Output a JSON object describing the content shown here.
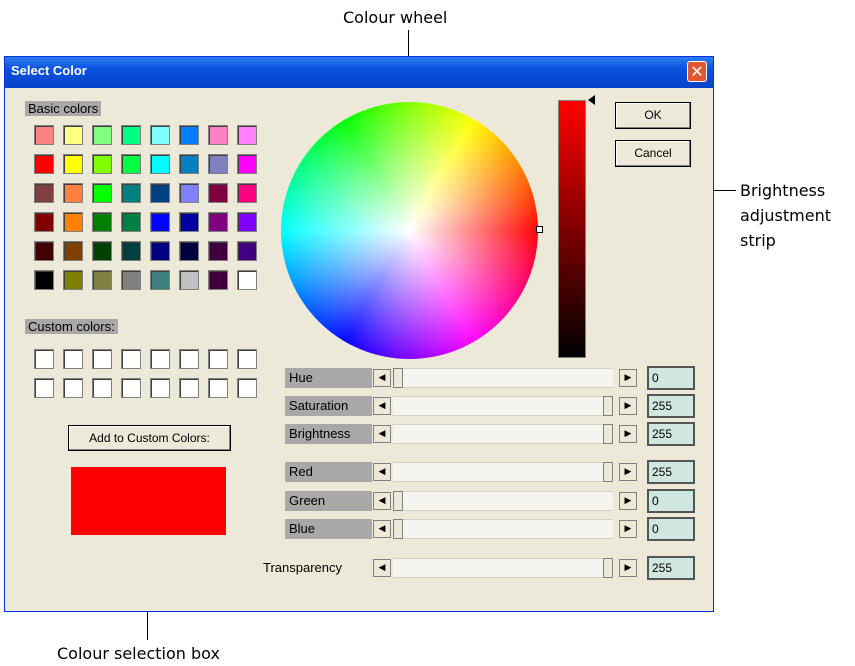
{
  "annotations": {
    "wheel": "Colour wheel",
    "brightness_line1": "Brightness",
    "brightness_line2": "adjustment",
    "brightness_line3": "strip",
    "selection": "Colour selection box"
  },
  "dialog": {
    "title": "Select Color",
    "basic_colors_label": "Basic colors",
    "custom_colors_label": "Custom colors:",
    "add_button": "Add to Custom Colors:",
    "ok_button": "OK",
    "cancel_button": "Cancel",
    "selected_color": "#ff0000"
  },
  "basic_colors": [
    [
      "#ff8080",
      "#ffff80",
      "#80ff80",
      "#00ff80",
      "#80ffff",
      "#0080ff",
      "#ff80c0",
      "#ff80ff"
    ],
    [
      "#ff0000",
      "#ffff00",
      "#80ff00",
      "#00ff40",
      "#00ffff",
      "#0080c0",
      "#8080c0",
      "#ff00ff"
    ],
    [
      "#804040",
      "#ff8040",
      "#00ff00",
      "#008080",
      "#004080",
      "#8080ff",
      "#800040",
      "#ff0080"
    ],
    [
      "#800000",
      "#ff8000",
      "#008000",
      "#008040",
      "#0000ff",
      "#0000a0",
      "#800080",
      "#8000ff"
    ],
    [
      "#400000",
      "#804000",
      "#004000",
      "#004040",
      "#000080",
      "#000040",
      "#400040",
      "#400080"
    ],
    [
      "#000000",
      "#808000",
      "#808040",
      "#808080",
      "#408080",
      "#c0c0c0",
      "#400040",
      "#ffffff"
    ]
  ],
  "sliders": [
    {
      "label": "Hue",
      "value": "0",
      "level": 0
    },
    {
      "label": "Saturation",
      "value": "255",
      "level": 1
    },
    {
      "label": "Brightness",
      "value": "255",
      "level": 1
    },
    {
      "label": "Red",
      "value": "255",
      "level": 1
    },
    {
      "label": "Green",
      "value": "0",
      "level": 0
    },
    {
      "label": "Blue",
      "value": "0",
      "level": 0
    },
    {
      "label": "Transparency",
      "value": "255",
      "level": 1
    }
  ],
  "icons": {
    "close": "close-icon",
    "left_arrow": "left-arrow-icon",
    "right_arrow": "right-arrow-icon"
  }
}
